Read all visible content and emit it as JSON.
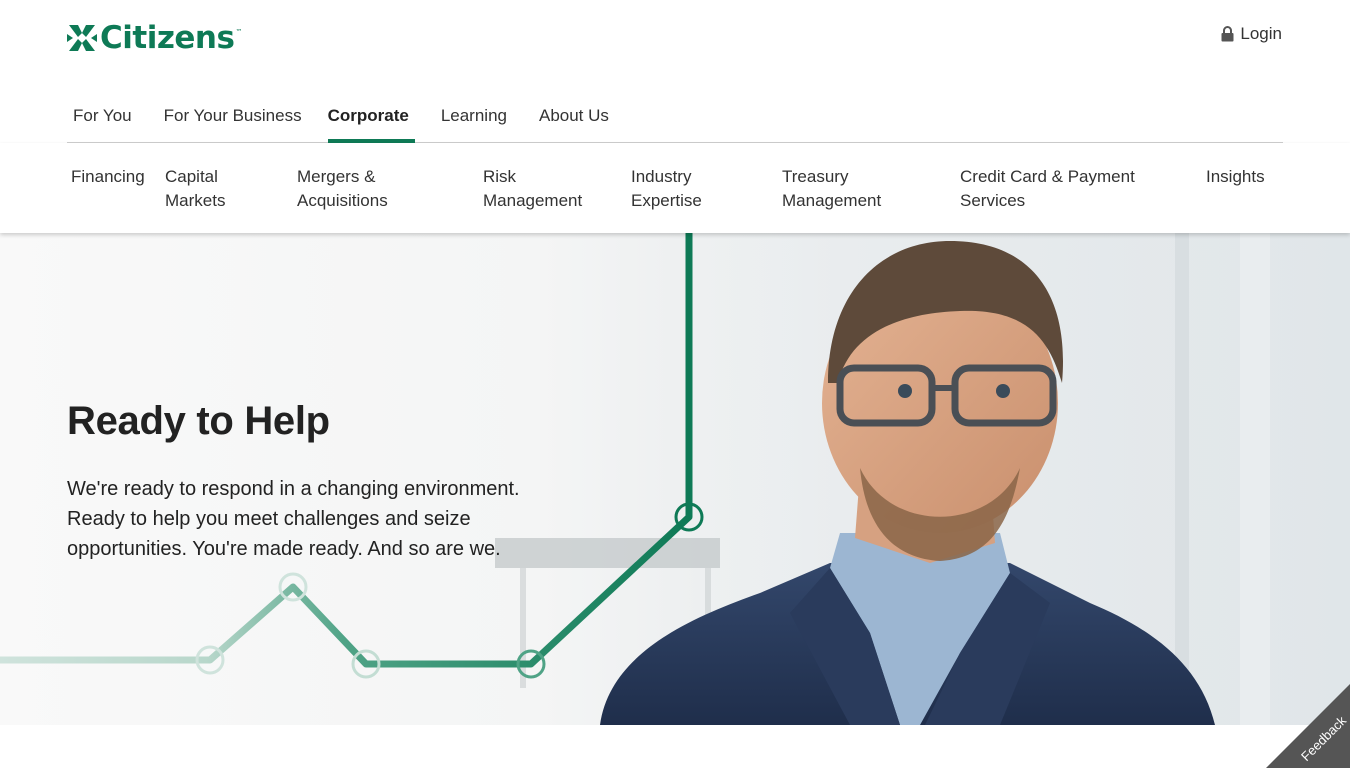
{
  "brand": {
    "name": "Citizens",
    "trademark": "™",
    "color": "#0e7a56"
  },
  "header": {
    "login_label": "Login",
    "login_icon": "lock-icon"
  },
  "primary_nav": [
    {
      "label": "For You"
    },
    {
      "label": "For Your Business"
    },
    {
      "label": "Corporate",
      "active": true
    },
    {
      "label": "Learning"
    },
    {
      "label": "About Us"
    }
  ],
  "secondary_nav": [
    {
      "line1": "Financing",
      "line2": ""
    },
    {
      "line1": "Capital",
      "line2": "Markets"
    },
    {
      "line1": "Mergers &",
      "line2": "Acquisitions"
    },
    {
      "line1": "Risk",
      "line2": "Management"
    },
    {
      "line1": "Industry",
      "line2": "Expertise"
    },
    {
      "line1": "Treasury",
      "line2": "Management"
    },
    {
      "line1": "Credit Card & Payment",
      "line2": "Services"
    },
    {
      "line1": "Insights",
      "line2": ""
    }
  ],
  "hero": {
    "headline": "Ready to Help",
    "body": "We're ready to respond in a changing environment. Ready to help you meet challenges and seize opportunities. You're made ready. And so are we."
  },
  "feedback": {
    "label": "Feedback"
  }
}
